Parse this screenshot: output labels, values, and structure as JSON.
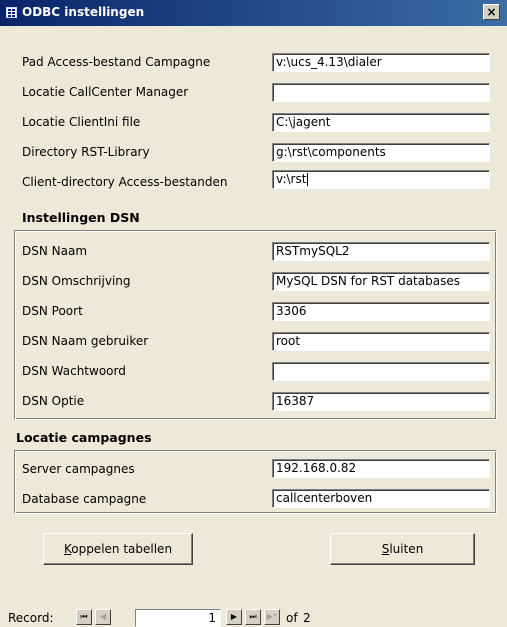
{
  "window": {
    "title": "ODBC instellingen",
    "close_glyph": "×"
  },
  "general": {
    "fields": [
      {
        "label": "Pad Access-bestand Campagne",
        "value": "v:\\ucs_4.13\\dialer"
      },
      {
        "label": "Locatie CallCenter Manager",
        "value": ""
      },
      {
        "label": "Locatie ClientIni file",
        "value": "C:\\jagent"
      },
      {
        "label": "Directory RST-Library",
        "value": "g:\\rst\\components"
      },
      {
        "label": "Client-directory Access-bestanden",
        "value": "v:\\rst"
      }
    ]
  },
  "dsn": {
    "title": "Instellingen DSN",
    "fields": [
      {
        "label": "DSN Naam",
        "value": "RSTmySQL2"
      },
      {
        "label": "DSN Omschrijving",
        "value": "MySQL DSN for RST databases"
      },
      {
        "label": "DSN Poort",
        "value": "3306"
      },
      {
        "label": "DSN Naam gebruiker",
        "value": "root"
      },
      {
        "label": "DSN Wachtwoord",
        "value": ""
      },
      {
        "label": "DSN Optie",
        "value": "16387"
      }
    ]
  },
  "campaigns": {
    "title": "Locatie campagnes",
    "fields": [
      {
        "label": "Server campagnes",
        "value": "192.168.0.82"
      },
      {
        "label": "Database campagne",
        "value": "callcenterboven"
      }
    ]
  },
  "buttons": {
    "link_tables": {
      "accel": "K",
      "rest": "oppelen tabellen"
    },
    "close": {
      "accel": "S",
      "rest": "luiten"
    }
  },
  "record_nav": {
    "label": "Record:",
    "current": "1",
    "of_label": "of",
    "total": "2",
    "first_glyph": "⏮",
    "prev_glyph": "◀",
    "next_glyph": "▶",
    "last_glyph": "⏭",
    "new_glyph": "▶*"
  }
}
